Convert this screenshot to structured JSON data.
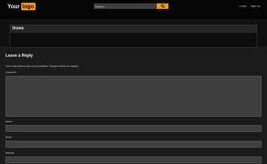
{
  "header": {
    "logo_text": "Your",
    "logo_highlight": "logo",
    "search_placeholder": "Search...",
    "search_icon": "magnifier-icon",
    "login_label": "Login",
    "signup_label": "Sign Up"
  },
  "breadcrumb": {
    "title": "Home"
  },
  "comments": {
    "title": "Leave a Reply",
    "notes": "Your email address will not be published. Required fields are marked",
    "required_mark": "*",
    "comment_label": "Comment",
    "name_label": "Name",
    "email_label": "Email",
    "website_label": "Website"
  },
  "colors": {
    "accent": "#f7971c",
    "header_bg": "#050505",
    "page_bg": "#1b1b1b",
    "field_bg": "#3e3e3e"
  }
}
